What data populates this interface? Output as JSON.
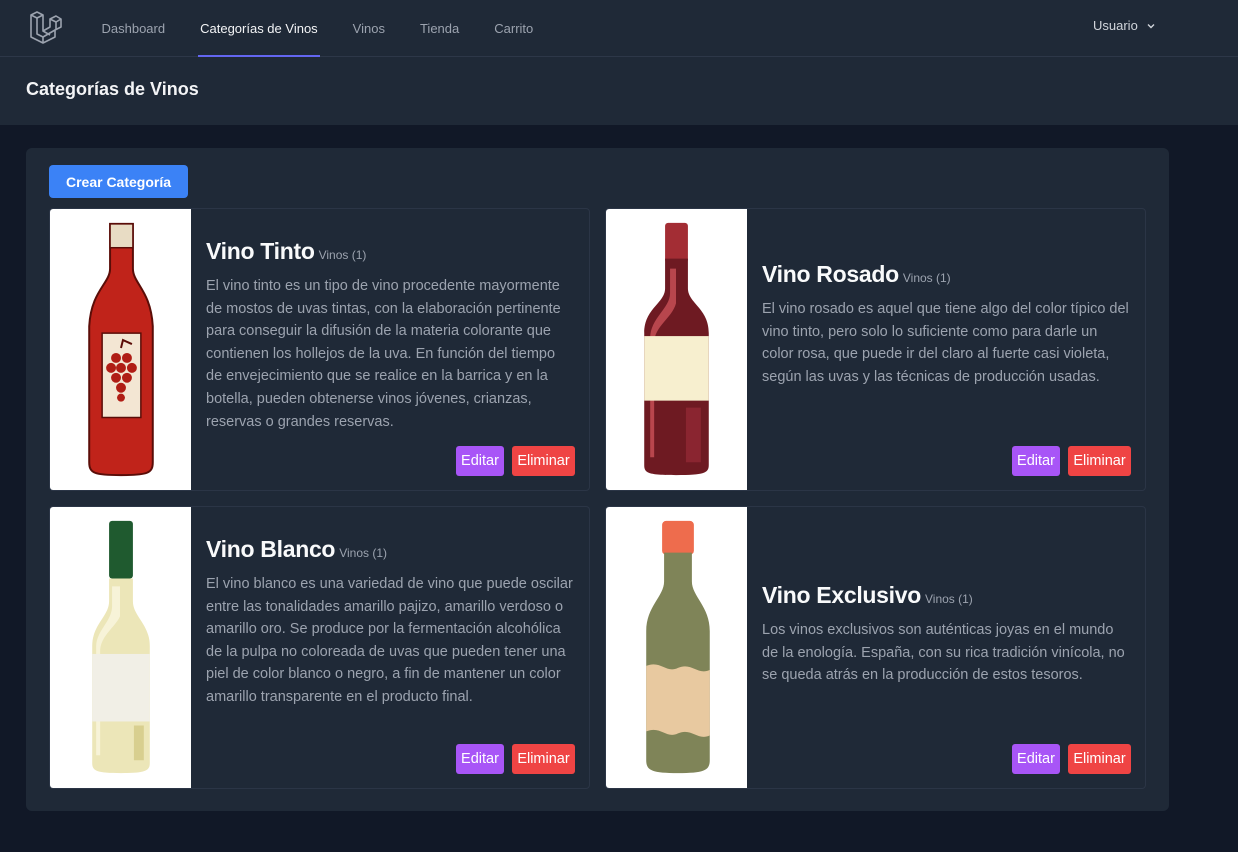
{
  "nav": {
    "links": [
      "Dashboard",
      "Categorías de Vinos",
      "Vinos",
      "Tienda",
      "Carrito"
    ],
    "active_index": 1,
    "user_label": "Usuario"
  },
  "header": {
    "title": "Categorías de Vinos"
  },
  "actions": {
    "create_label": "Crear Categoría"
  },
  "colors": {
    "accent_active": "#6366f1",
    "create_button": "#3b82f6",
    "edit_button": "#a855f7",
    "delete_button": "#ef4444"
  },
  "categories": [
    {
      "name": "Vino Tinto",
      "count": "Vinos (1)",
      "description": "El vino tinto es un tipo de vino procedente mayormente de mostos de uvas tintas, con la elaboración pertinente para conseguir la difusión de la materia colorante que contienen los hollejos de la uva. En función del tiempo de envejecimiento que se realice en la barrica y en la botella, pueden obtenerse vinos jóvenes, crianzas, reservas o grandes reservas.",
      "image": "red-wine-bottle",
      "edit_label": "Editar",
      "delete_label": "Eliminar"
    },
    {
      "name": "Vino Rosado",
      "count": "Vinos (1)",
      "description": "El vino rosado es aquel que tiene algo del color típico del vino tinto, pero solo lo suficiente como para darle un color rosa, que puede ir del claro al fuerte casi violeta, según las uvas y las técnicas de producción usadas.",
      "image": "rose-wine-bottle",
      "edit_label": "Editar",
      "delete_label": "Eliminar"
    },
    {
      "name": "Vino Blanco",
      "count": "Vinos (1)",
      "description": "El vino blanco es una variedad de vino que puede oscilar entre las tonalidades amarillo pajizo, amarillo verdoso o amarillo oro. Se produce por la fermentación alcohólica de la pulpa no coloreada de uvas que pueden tener una piel de color blanco o negro, a fin de mantener un color amarillo transparente en el producto final.",
      "image": "white-wine-bottle",
      "edit_label": "Editar",
      "delete_label": "Eliminar"
    },
    {
      "name": "Vino Exclusivo",
      "count": "Vinos (1)",
      "description": "Los vinos exclusivos son auténticas joyas en el mundo de la enología. España, con su rica tradición vinícola, no se queda atrás en la producción de estos tesoros.",
      "image": "exclusive-wine-bottle",
      "edit_label": "Editar",
      "delete_label": "Eliminar"
    }
  ]
}
